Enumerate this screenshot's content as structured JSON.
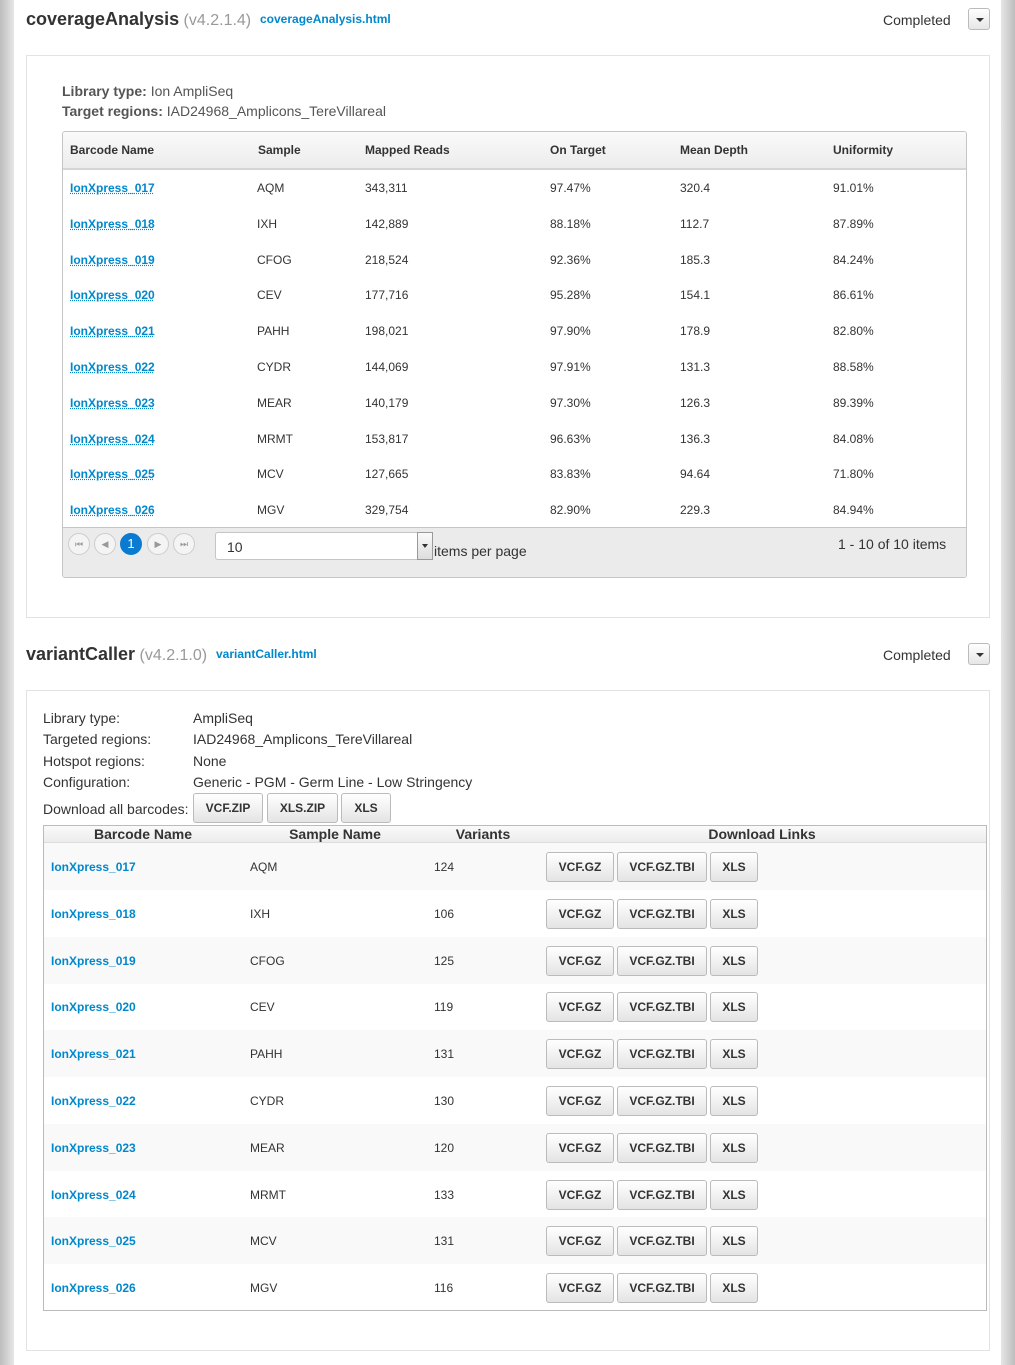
{
  "coverage": {
    "title": "coverageAnalysis",
    "version": "(v4.2.1.4)",
    "link": "coverageAnalysis.html",
    "status": "Completed",
    "library_type_label": "Library type:",
    "library_type": "Ion AmpliSeq",
    "target_regions_label": "Target regions:",
    "target_regions": "IAD24968_Amplicons_TereVillareal",
    "columns": [
      "Barcode Name",
      "Sample",
      "Mapped Reads",
      "On Target",
      "Mean Depth",
      "Uniformity"
    ],
    "rows": [
      [
        "IonXpress_017",
        "AQM",
        "343,311",
        "97.47%",
        "320.4",
        "91.01%"
      ],
      [
        "IonXpress_018",
        "IXH",
        "142,889",
        "88.18%",
        "112.7",
        "87.89%"
      ],
      [
        "IonXpress_019",
        "CFOG",
        "218,524",
        "92.36%",
        "185.3",
        "84.24%"
      ],
      [
        "IonXpress_020",
        "CEV",
        "177,716",
        "95.28%",
        "154.1",
        "86.61%"
      ],
      [
        "IonXpress_021",
        "PAHH",
        "198,021",
        "97.90%",
        "178.9",
        "82.80%"
      ],
      [
        "IonXpress_022",
        "CYDR",
        "144,069",
        "97.91%",
        "131.3",
        "88.58%"
      ],
      [
        "IonXpress_023",
        "MEAR",
        "140,179",
        "97.30%",
        "126.3",
        "89.39%"
      ],
      [
        "IonXpress_024",
        "MRMT",
        "153,817",
        "96.63%",
        "136.3",
        "84.08%"
      ],
      [
        "IonXpress_025",
        "MCV",
        "127,665",
        "83.83%",
        "94.64",
        "71.80%"
      ],
      [
        "IonXpress_026",
        "MGV",
        "329,754",
        "82.90%",
        "229.3",
        "84.94%"
      ]
    ],
    "pager": {
      "current_page": "1",
      "page_size": "10",
      "items_per_page_label": "items per page",
      "summary": "1 - 10 of 10 items"
    }
  },
  "variant": {
    "title": "variantCaller",
    "version": "(v4.2.1.0)",
    "link": "variantCaller.html",
    "status": "Completed",
    "info": [
      {
        "label": "Library type:",
        "value": "AmpliSeq"
      },
      {
        "label": "Targeted regions:",
        "value": "IAD24968_Amplicons_TereVillareal"
      },
      {
        "label": "Hotspot regions:",
        "value": "None"
      },
      {
        "label": "Configuration:",
        "value": "Generic - PGM - Germ Line - Low Stringency"
      }
    ],
    "download_all_label": "Download all barcodes:",
    "download_all_buttons": [
      "VCF.ZIP",
      "XLS.ZIP",
      "XLS"
    ],
    "columns": [
      "Barcode Name",
      "Sample Name",
      "Variants",
      "Download Links"
    ],
    "row_buttons": [
      "VCF.GZ",
      "VCF.GZ.TBI",
      "XLS"
    ],
    "rows": [
      [
        "IonXpress_017",
        "AQM",
        "124"
      ],
      [
        "IonXpress_018",
        "IXH",
        "106"
      ],
      [
        "IonXpress_019",
        "CFOG",
        "125"
      ],
      [
        "IonXpress_020",
        "CEV",
        "119"
      ],
      [
        "IonXpress_021",
        "PAHH",
        "131"
      ],
      [
        "IonXpress_022",
        "CYDR",
        "130"
      ],
      [
        "IonXpress_023",
        "MEAR",
        "120"
      ],
      [
        "IonXpress_024",
        "MRMT",
        "133"
      ],
      [
        "IonXpress_025",
        "MCV",
        "131"
      ],
      [
        "IonXpress_026",
        "MGV",
        "116"
      ]
    ]
  }
}
